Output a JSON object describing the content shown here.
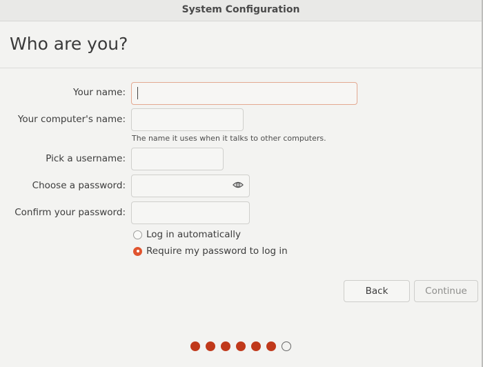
{
  "window": {
    "title": "System Configuration"
  },
  "page": {
    "heading": "Who are you?"
  },
  "form": {
    "your_name": {
      "label": "Your name:",
      "value": ""
    },
    "computer_name": {
      "label": "Your computer's name:",
      "value": "",
      "hint": "The name it uses when it talks to other computers."
    },
    "username": {
      "label": "Pick a username:",
      "value": ""
    },
    "password": {
      "label": "Choose a password:",
      "value": "",
      "toggle_icon": "eye-icon"
    },
    "confirm_password": {
      "label": "Confirm your password:",
      "value": ""
    },
    "login_options": [
      {
        "label": "Log in automatically",
        "checked": false
      },
      {
        "label": "Require my password to log in",
        "checked": true
      }
    ]
  },
  "buttons": {
    "back": "Back",
    "continue": "Continue"
  },
  "progress": {
    "total_steps": 7,
    "completed_steps": 6
  },
  "colors": {
    "accent": "#e0542f",
    "progress_dot": "#c0391b",
    "focus_border": "#e3a890"
  }
}
